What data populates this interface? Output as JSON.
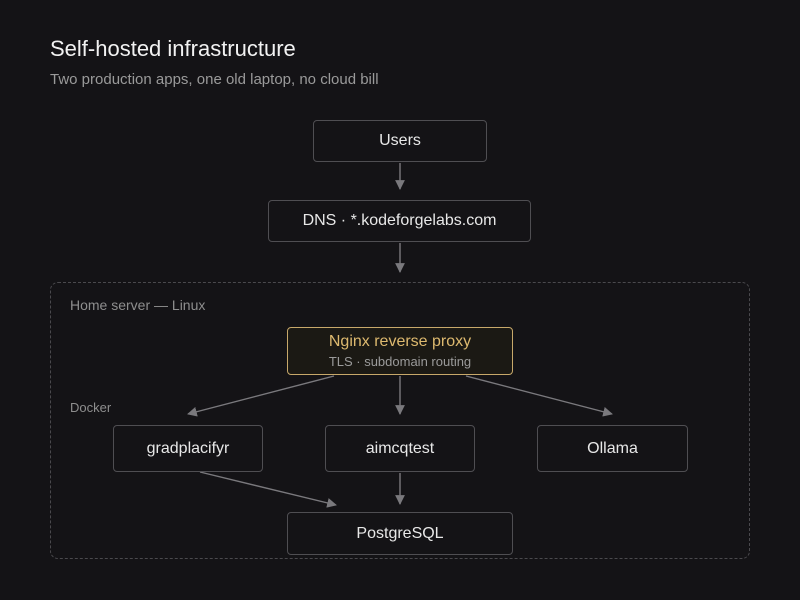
{
  "header": {
    "title": "Self-hosted infrastructure",
    "subtitle": "Two production apps, one old laptop, no cloud bill"
  },
  "groups": {
    "home_server": "Home server — Linux",
    "docker": "Docker"
  },
  "nodes": {
    "users": "Users",
    "dns": "DNS · *.kodeforgelabs.com",
    "proxy_title": "Nginx reverse proxy",
    "proxy_subtitle": "TLS · subdomain routing",
    "gradplacifyr": "gradplacifyr",
    "aimcqtest": "aimcqtest",
    "ollama": "Ollama",
    "postgres": "PostgreSQL"
  },
  "edges": [
    {
      "from": "Users",
      "to": "DNS · *.kodeforgelabs.com"
    },
    {
      "from": "DNS · *.kodeforgelabs.com",
      "to": "Nginx reverse proxy"
    },
    {
      "from": "Nginx reverse proxy",
      "to": "gradplacifyr"
    },
    {
      "from": "Nginx reverse proxy",
      "to": "aimcqtest"
    },
    {
      "from": "Nginx reverse proxy",
      "to": "Ollama"
    },
    {
      "from": "gradplacifyr",
      "to": "PostgreSQL"
    },
    {
      "from": "aimcqtest",
      "to": "PostgreSQL"
    }
  ],
  "colors": {
    "background": "#141316",
    "node_border": "#4f4e52",
    "accent": "#ddb96f",
    "edge": "#7a797d"
  }
}
